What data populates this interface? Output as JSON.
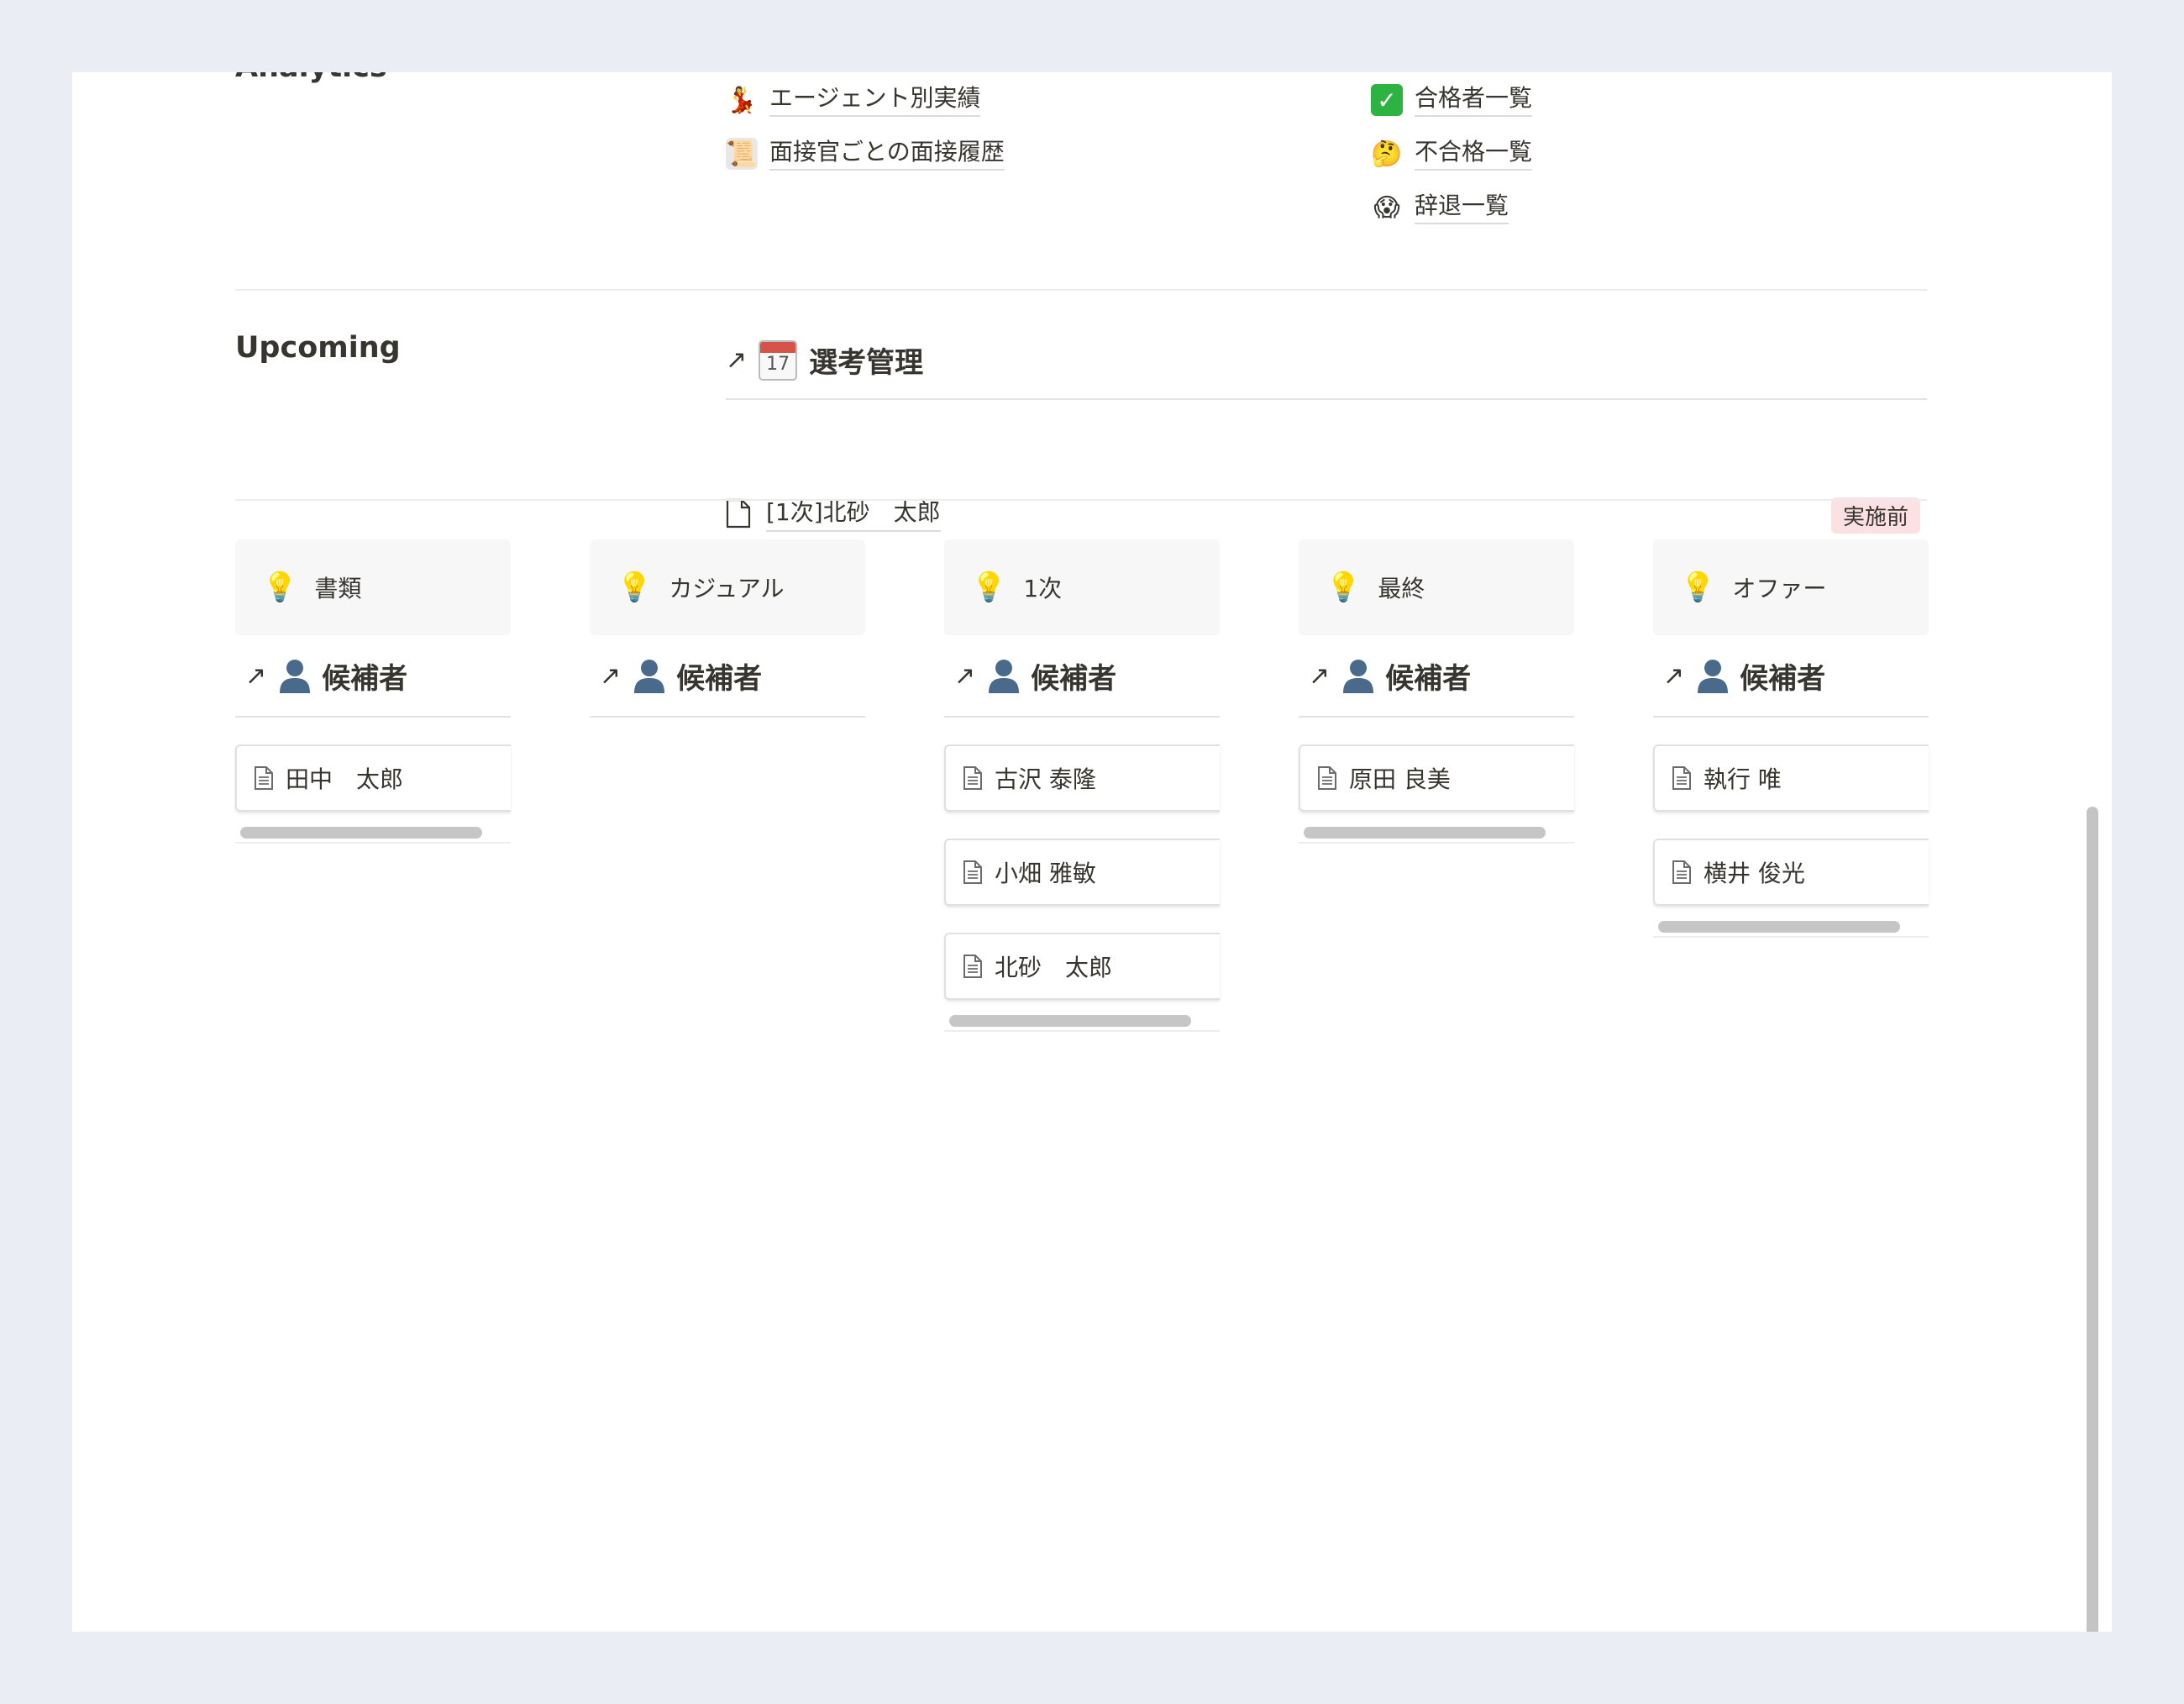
{
  "analytics": {
    "label": "Analytics",
    "left_links": [
      {
        "icon": "dancer-icon",
        "label": "エージェント別実績"
      },
      {
        "icon": "scroll-icon",
        "label": "面接官ごとの面接履歴"
      }
    ],
    "right_links": [
      {
        "icon": "check-mark-icon",
        "label": "合格者一覧"
      },
      {
        "icon": "thinking-face-icon",
        "label": "不合格一覧"
      },
      {
        "icon": "screaming-face-icon",
        "label": "辞退一覧"
      }
    ]
  },
  "upcoming": {
    "label": "Upcoming",
    "db_title": "選考管理",
    "calendar_day": "17",
    "rows": [
      {
        "title": "[1次]北砂　太郎",
        "status": "実施前",
        "status_color": "#fbe0e4"
      }
    ]
  },
  "columns": [
    {
      "stage": "書類",
      "db_title": "候補者",
      "cards": [
        "田中　太郎"
      ]
    },
    {
      "stage": "カジュアル",
      "db_title": "候補者",
      "cards": []
    },
    {
      "stage": "1次",
      "db_title": "候補者",
      "cards": [
        "古沢 泰隆",
        "小畑 雅敏",
        "北砂　太郎"
      ]
    },
    {
      "stage": "最終",
      "db_title": "候補者",
      "cards": [
        "原田 良美"
      ]
    },
    {
      "stage": "オファー",
      "db_title": "候補者",
      "cards": [
        "執行 唯",
        "横井 俊光"
      ]
    }
  ]
}
